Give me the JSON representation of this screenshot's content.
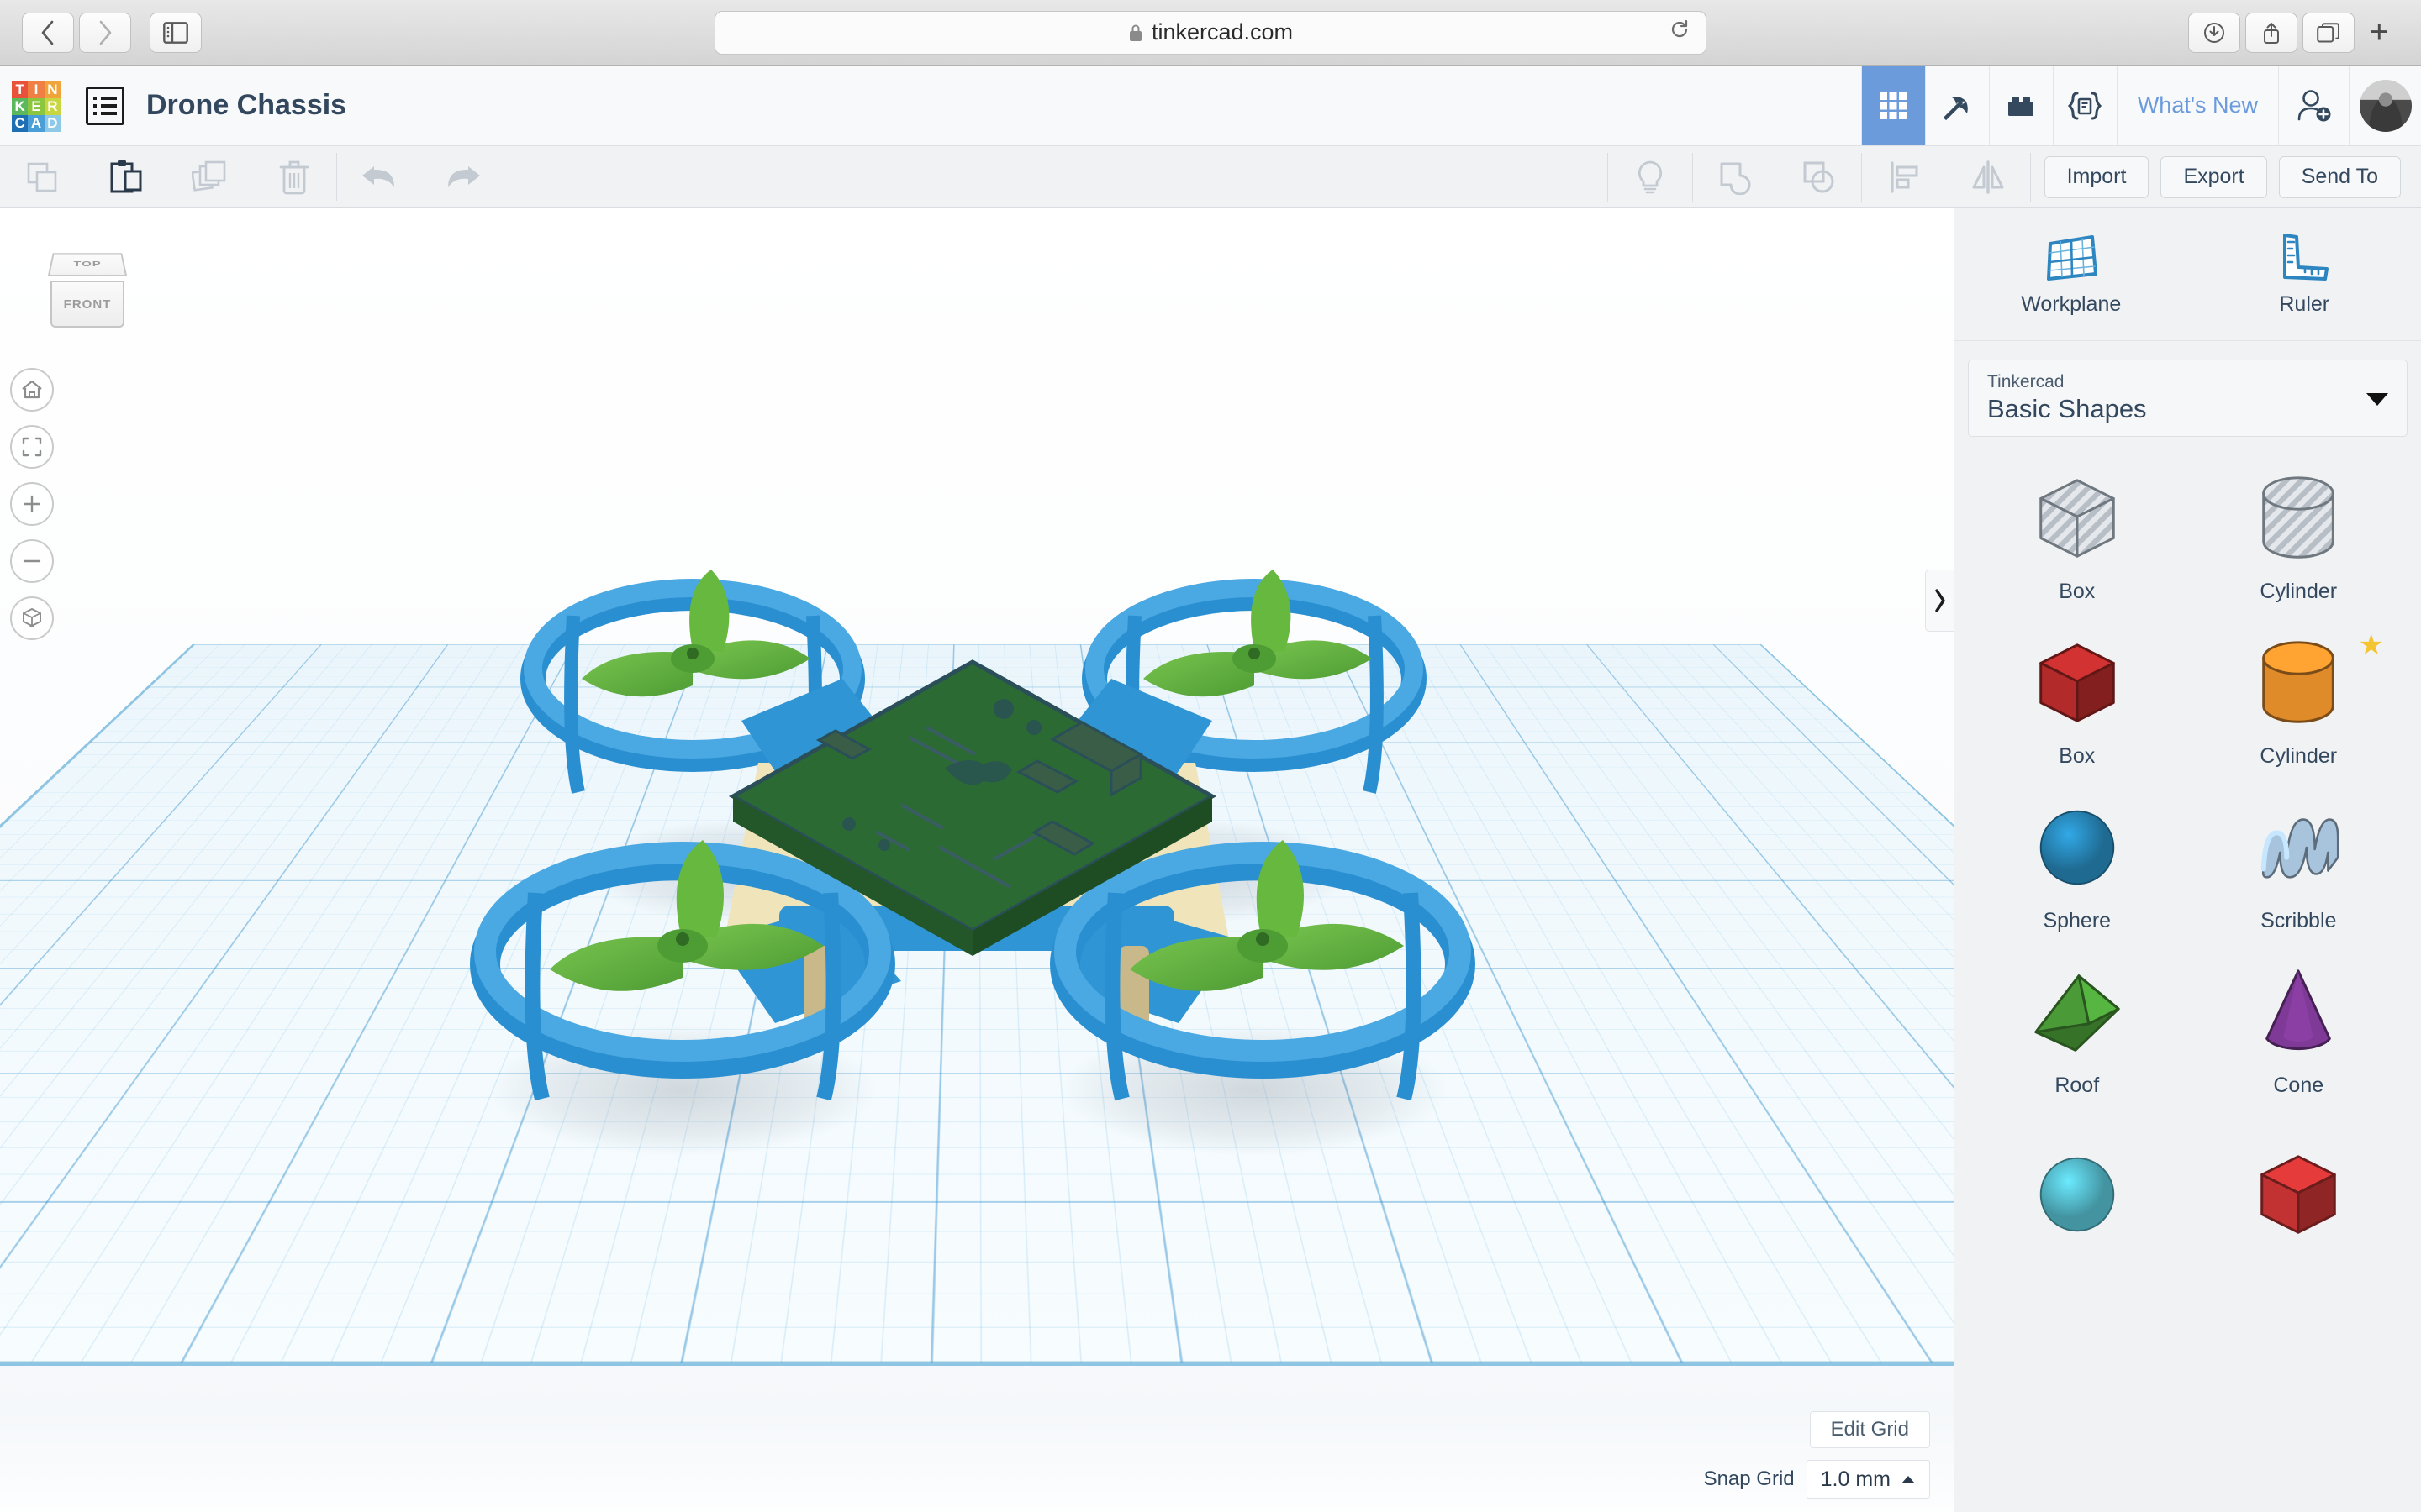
{
  "browser": {
    "url": "tinkercad.com",
    "lock_icon": "lock-icon",
    "back_icon": "chevron-left-icon",
    "forward_icon": "chevron-right-icon",
    "sidebar_icon": "sidebar-toggle-icon",
    "reload_icon": "reload-icon",
    "download_icon": "download-icon",
    "share_icon": "share-icon",
    "tabs_icon": "tab-overview-icon",
    "newtab_label": "+"
  },
  "header": {
    "logo_letters": [
      "T",
      "I",
      "N",
      "K",
      "E",
      "R",
      "C",
      "A",
      "D"
    ],
    "logo_colors": [
      "#e8513a",
      "#f07f43",
      "#f0a43c",
      "#5cb85c",
      "#8cc63f",
      "#c8d741",
      "#1f6fb5",
      "#4a9fd8",
      "#8ec9e8"
    ],
    "menu_icon": "list-menu-icon",
    "title": "Drone Chassis",
    "modes": [
      {
        "name": "3d-design-mode",
        "icon": "grid-3x3-icon",
        "active": true
      },
      {
        "name": "minecraft-mode",
        "icon": "pickaxe-icon",
        "active": false
      },
      {
        "name": "blocks-mode",
        "icon": "lego-brick-icon",
        "active": false
      },
      {
        "name": "codeblocks-mode",
        "icon": "code-braces-icon",
        "active": false
      }
    ],
    "whats_new": "What's New",
    "invite_icon": "person-add-icon",
    "avatar_name": "user-avatar"
  },
  "toolbar": {
    "left_tools": [
      {
        "name": "copy-button",
        "icon": "copy-icon",
        "enabled": false
      },
      {
        "name": "paste-button",
        "icon": "clipboard-paste-icon",
        "enabled": true
      },
      {
        "name": "duplicate-button",
        "icon": "duplicate-icon",
        "enabled": false
      },
      {
        "name": "delete-button",
        "icon": "trash-icon",
        "enabled": false
      }
    ],
    "history_tools": [
      {
        "name": "undo-button",
        "icon": "undo-arrow-icon",
        "enabled": false
      },
      {
        "name": "redo-button",
        "icon": "redo-arrow-icon",
        "enabled": false
      }
    ],
    "object_tools": [
      {
        "name": "hints-button",
        "icon": "lightbulb-icon",
        "enabled": false
      },
      {
        "name": "group-button",
        "icon": "group-shapes-icon",
        "enabled": false
      },
      {
        "name": "ungroup-button",
        "icon": "ungroup-shapes-icon",
        "enabled": false
      }
    ],
    "arrange_tools": [
      {
        "name": "align-button",
        "icon": "align-icon",
        "enabled": false
      },
      {
        "name": "mirror-button",
        "icon": "mirror-flip-icon",
        "enabled": false
      }
    ],
    "import_label": "Import",
    "export_label": "Export",
    "sendto_label": "Send To"
  },
  "viewcube": {
    "top_label": "TOP",
    "front_label": "FRONT"
  },
  "view_controls": [
    {
      "name": "home-view-button",
      "icon": "home-icon"
    },
    {
      "name": "fit-view-button",
      "icon": "fit-frame-icon"
    },
    {
      "name": "zoom-in-button",
      "icon": "plus-icon"
    },
    {
      "name": "zoom-out-button",
      "icon": "minus-icon"
    },
    {
      "name": "projection-toggle-button",
      "icon": "cube-perspective-icon"
    }
  ],
  "canvas": {
    "edit_grid_label": "Edit Grid",
    "snap_grid_label": "Snap Grid",
    "snap_grid_value": "1.0 mm",
    "snap_caret": "caret-up-icon",
    "collapse_icon": "chevron-right-icon",
    "model_name": "drone-chassis-model",
    "colors": {
      "frame_blue": "#2a8fd0",
      "frame_blue_light": "#3fa3de",
      "propeller_green": "#5cb53f",
      "pcb_green": "#2b6b33",
      "grid_blue": "#8ec5e2",
      "accent_tan": "#efe3b8"
    }
  },
  "panel": {
    "tools": [
      {
        "name": "workplane-tool",
        "label": "Workplane",
        "icon": "workplane-grid-icon"
      },
      {
        "name": "ruler-tool",
        "label": "Ruler",
        "icon": "ruler-icon"
      }
    ],
    "library_vendor": "Tinkercad",
    "library_value": "Basic Shapes",
    "shapes": [
      {
        "name": "shape-box-hole",
        "label": "Box",
        "style": "hole",
        "geom": "cube",
        "color": "#b9c0c7",
        "star": false
      },
      {
        "name": "shape-cylinder-hole",
        "label": "Cylinder",
        "style": "hole",
        "geom": "cylinder",
        "color": "#b9c0c7",
        "star": false
      },
      {
        "name": "shape-box-solid",
        "label": "Box",
        "style": "solid",
        "geom": "cube",
        "color": "#b32a2a",
        "star": false
      },
      {
        "name": "shape-cylinder-solid",
        "label": "Cylinder",
        "style": "solid",
        "geom": "cylinder",
        "color": "#e08b2a",
        "star": true
      },
      {
        "name": "shape-sphere",
        "label": "Sphere",
        "style": "solid",
        "geom": "sphere",
        "color": "#2a8fc4",
        "star": false
      },
      {
        "name": "shape-scribble",
        "label": "Scribble",
        "style": "solid",
        "geom": "scribble",
        "color": "#a8c4dd",
        "star": false
      },
      {
        "name": "shape-roof",
        "label": "Roof",
        "style": "solid",
        "geom": "roof",
        "color": "#4a9a38",
        "star": false
      },
      {
        "name": "shape-cone",
        "label": "Cone",
        "style": "solid",
        "geom": "cone",
        "color": "#7e3a96",
        "star": false
      },
      {
        "name": "shape-partial-left",
        "label": "",
        "style": "solid",
        "geom": "sphere",
        "color": "#5bc6d8",
        "star": false
      },
      {
        "name": "shape-partial-right",
        "label": "",
        "style": "solid",
        "geom": "cube",
        "color": "#c23232",
        "star": false
      }
    ]
  }
}
